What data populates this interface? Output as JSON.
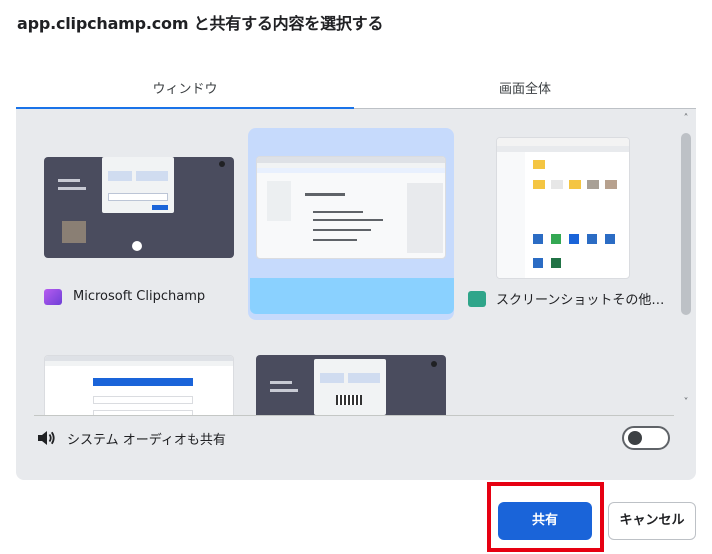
{
  "dialog": {
    "title": "app.clipchamp.com と共有する内容を選択する"
  },
  "tabs": [
    {
      "label": "ウィンドウ",
      "selected": true
    },
    {
      "label": "画面全体",
      "selected": false
    }
  ],
  "windows": [
    {
      "label": "Microsoft Clipchamp",
      "icon": "clipchamp-icon",
      "selected": false
    },
    {
      "label": "",
      "icon": "",
      "selected": true
    },
    {
      "label": "スクリーンショットその他のタ...",
      "icon": "file-explorer-icon",
      "selected": false
    },
    {
      "label": "",
      "icon": "",
      "selected": false
    },
    {
      "label": "",
      "icon": "",
      "selected": false
    }
  ],
  "audio": {
    "label": "システム オーディオも共有",
    "enabled": false
  },
  "buttons": {
    "share": "共有",
    "cancel": "キャンセル"
  },
  "colors": {
    "accent": "#1a73e8",
    "share_button": "#1a64d9",
    "selected_tile": "#c6dafc",
    "highlight": "#e60012"
  }
}
